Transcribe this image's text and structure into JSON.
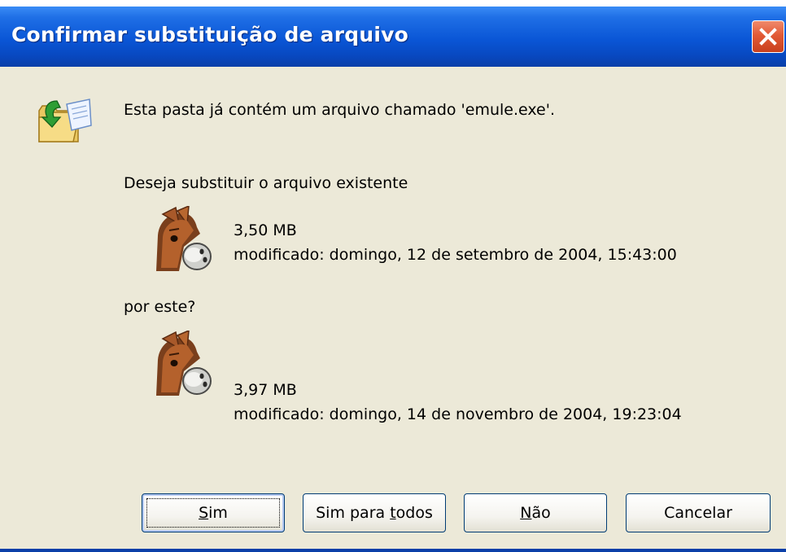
{
  "dialog": {
    "title": "Confirmar substituição de arquivo",
    "message": "Esta pasta já contém um arquivo chamado 'emule.exe'.",
    "question": "Deseja substituir o arquivo existente",
    "replace_prompt": "por este?",
    "existing_file": {
      "icon": "emule-donkey-icon",
      "size": "3,50 MB",
      "modified": "modificado: domingo, 12 de setembro de 2004, 15:43:00"
    },
    "new_file": {
      "icon": "emule-donkey-icon",
      "size": "3,97 MB",
      "modified": "modificado: domingo, 14 de novembro de 2004, 19:23:04"
    }
  },
  "buttons": {
    "yes": {
      "pre": "",
      "accel": "S",
      "post": "im"
    },
    "yes_all": {
      "pre": "Sim para ",
      "accel": "t",
      "post": "odos"
    },
    "no": {
      "pre": "",
      "accel": "N",
      "post": "ão"
    },
    "cancel": {
      "pre": "Cancelar",
      "accel": "",
      "post": ""
    }
  },
  "colors": {
    "titlebar": "#0a56d6",
    "dialog_bg": "#ece9d8",
    "close_button": "#e25a36",
    "button_border": "#003c74"
  }
}
